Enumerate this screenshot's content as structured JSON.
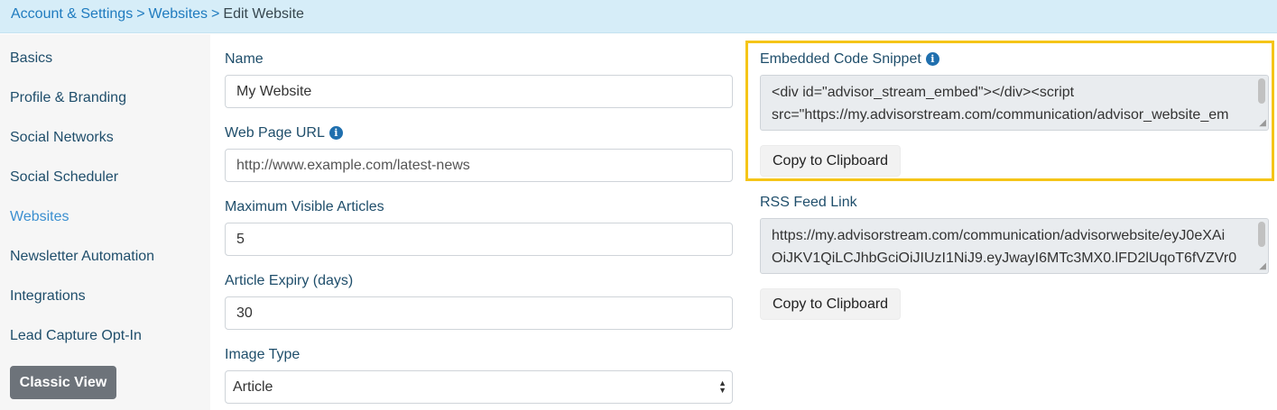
{
  "breadcrumb": {
    "items": [
      {
        "label": "Account & Settings"
      },
      {
        "label": "Websites"
      },
      {
        "label": "Edit Website"
      }
    ],
    "separator": ">"
  },
  "sidebar": {
    "items": [
      {
        "label": "Basics"
      },
      {
        "label": "Profile & Branding"
      },
      {
        "label": "Social Networks"
      },
      {
        "label": "Social Scheduler"
      },
      {
        "label": "Websites",
        "active": true
      },
      {
        "label": "Newsletter Automation"
      },
      {
        "label": "Integrations"
      },
      {
        "label": "Lead Capture Opt-In"
      }
    ],
    "classic_view_label": "Classic View"
  },
  "form": {
    "name": {
      "label": "Name",
      "value": "My Website"
    },
    "url": {
      "label": "Web Page URL",
      "value": "http://www.example.com/latest-news"
    },
    "max_articles": {
      "label": "Maximum Visible Articles",
      "value": "5"
    },
    "expiry": {
      "label": "Article Expiry (days)",
      "value": "30"
    },
    "image_type": {
      "label": "Image Type",
      "value": "Article"
    }
  },
  "embed": {
    "label": "Embedded Code Snippet",
    "line1": "<div id=\"advisor_stream_embed\"></div><script",
    "line2": "src=\"https://my.advisorstream.com/communication/advisor_website_em",
    "copy_label": "Copy to Clipboard"
  },
  "rss": {
    "label": "RSS Feed Link",
    "line1": "https://my.advisorstream.com/communication/advisorwebsite/eyJ0eXAi",
    "line2": "OiJKV1QiLCJhbGciOiJIUzI1NiJ9.eyJwayI6MTc3MX0.lFD2lUqoT6fVZVr0",
    "copy_label": "Copy to Clipboard"
  },
  "colors": {
    "breadcrumb_bg": "#d6edf8",
    "link": "#1f7bbf",
    "highlight": "#f5c518",
    "classic_button": "#6d737a"
  },
  "icons": {
    "info": "info-circle-icon",
    "select": "select-arrows-icon"
  }
}
